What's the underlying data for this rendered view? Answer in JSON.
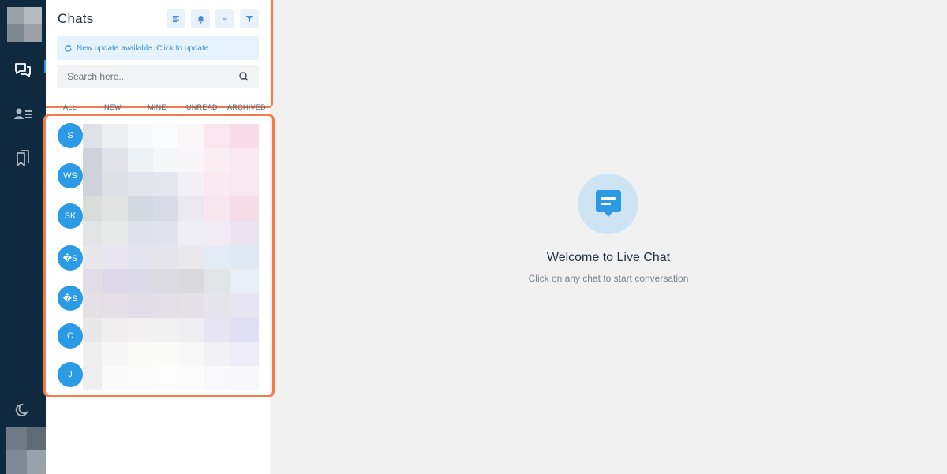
{
  "rail": {
    "logo_colors": [
      "#9aa1a7",
      "#b7bcc1",
      "#7f878f",
      "#9ba1a7"
    ],
    "nav_items": [
      {
        "name": "chats",
        "icon": "chat-bubbles-icon",
        "active": true
      },
      {
        "name": "contacts",
        "icon": "contact-list-icon",
        "active": false
      },
      {
        "name": "bookmarks",
        "icon": "bookmarks-icon",
        "active": false
      }
    ],
    "theme_toggle_icon": "moon-icon",
    "avatar_colors": [
      "#6f7a84",
      "#5f6b75",
      "#9aa3ab",
      "#7f8a94",
      "#98a2aa",
      "#c9cfd3"
    ]
  },
  "panel": {
    "title": "Chats",
    "header_buttons": [
      "align-left-icon",
      "bell-icon",
      "sort-lines-icon",
      "filter-icon"
    ],
    "update_banner": "New update available. Click to update",
    "search_placeholder": "Search here..",
    "tabs": [
      "ALL",
      "NEW",
      "MINE",
      "UNREAD",
      "ARCHIVED"
    ],
    "chats": [
      {
        "initials": "S"
      },
      {
        "initials": "WS"
      },
      {
        "initials": "SK"
      },
      {
        "initials": "�S"
      },
      {
        "initials": "�S"
      },
      {
        "initials": "C"
      },
      {
        "initials": "J"
      }
    ]
  },
  "main": {
    "welcome_title": "Welcome to Live Chat",
    "welcome_subtitle": "Click on any chat to start conversation",
    "welcome_icon": "chat-message-icon"
  },
  "colors": {
    "accent": "#2a9be4",
    "highlight": "#f47b4b",
    "rail_bg": "#0f2a3f"
  }
}
